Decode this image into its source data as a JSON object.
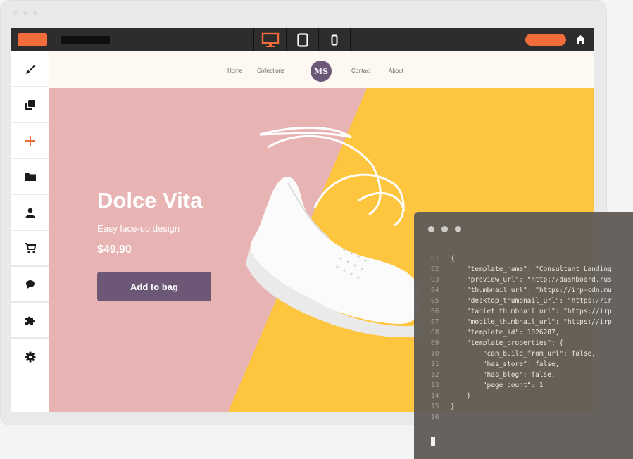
{
  "topbar": {
    "device_modes": [
      "desktop",
      "tablet",
      "mobile"
    ],
    "active_mode": "desktop",
    "accent_color": "#f26b3a"
  },
  "sidebar": {
    "items": [
      {
        "icon": "brush-icon"
      },
      {
        "icon": "layers-icon"
      },
      {
        "icon": "plus-icon"
      },
      {
        "icon": "folder-icon"
      },
      {
        "icon": "user-icon"
      },
      {
        "icon": "cart-icon"
      },
      {
        "icon": "chat-icon"
      },
      {
        "icon": "puzzle-icon"
      },
      {
        "icon": "gear-icon"
      }
    ]
  },
  "site": {
    "nav": {
      "home": "Home",
      "collections": "Collections",
      "logo_text": "MS",
      "contact": "Contact",
      "about": "About"
    },
    "hero": {
      "title": "Dolce Vita",
      "subtitle": "Easy lace-up design",
      "price": "$49,90",
      "cta": "Add to bag",
      "bg_left": "#e7b3b3",
      "bg_right": "#fec53f"
    }
  },
  "code_panel": {
    "lines": [
      {
        "n": "01",
        "text": "{"
      },
      {
        "n": "02",
        "text": "    \"template_name\": \"Consultant Landing"
      },
      {
        "n": "03",
        "text": "    \"preview_url\": \"http://dashboard.rus"
      },
      {
        "n": "04",
        "text": "    \"thumbnail_url\": \"https://irp-cdn.mu"
      },
      {
        "n": "05",
        "text": "    \"desktop_thumbnail_url\": \"https://ir"
      },
      {
        "n": "06",
        "text": "    \"tablet_thumbnail_url\": \"https://irp"
      },
      {
        "n": "07",
        "text": "    \"mobile_thumbnail_url\": \"https://irp"
      },
      {
        "n": "08",
        "text": "    \"template_id\": 1026287,"
      },
      {
        "n": "09",
        "text": "    \"template_properties\": {"
      },
      {
        "n": "10",
        "text": "        \"can_build_from_url\": false,"
      },
      {
        "n": "11",
        "text": "        \"has_store\": false,"
      },
      {
        "n": "12",
        "text": "        \"has_blog\": false,"
      },
      {
        "n": "13",
        "text": "        \"page_count\": 1"
      },
      {
        "n": "14",
        "text": "    }"
      },
      {
        "n": "15",
        "text": "}"
      },
      {
        "n": "16",
        "text": ""
      }
    ]
  }
}
